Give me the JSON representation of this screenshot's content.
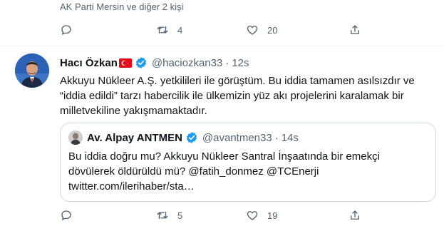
{
  "previous_tweet": {
    "liked_by": "AK Parti Mersin ve diğer 2 kişi",
    "retweets": "4",
    "likes": "20"
  },
  "tweet": {
    "name": "Hacı Özkan",
    "handle": "@haciozkan33",
    "dot": "·",
    "time": "12s",
    "lines": [
      "Akkuyu Nükleer A.Ş. yetkilileri ile görüştüm. Bu iddia tamamen asılsızdır ve",
      "“iddia edildi” tarzı habercilik ile ülkemizin yüz akı projelerini karalamak bir",
      "milletvekiline yakışmamaktadır."
    ],
    "retweets": "5",
    "likes": "19"
  },
  "quoted_tweet": {
    "name": "Av. Alpay ANTMEN",
    "handle": "@avantmen33",
    "dot": "·",
    "time": "14s",
    "lines": [
      "Bu iddia doğru mu? Akkuyu Nükleer Santral İnşaatında bir emekçi",
      "dövülerek öldürüldü mü? @fatih_donmez @TCEnerji",
      "twitter.com/ilerihaber/sta…"
    ]
  },
  "icons": {
    "reply": "reply-icon",
    "retweet": "retweet-icon",
    "like": "heart-icon",
    "share": "share-icon",
    "verified": "verified-badge-icon",
    "flag": "turkey-flag-icon"
  },
  "colors": {
    "secondary_text": "#536471",
    "verified_blue": "#1d9bf0",
    "flag_red": "#e30a17",
    "border": "#cfd9de"
  }
}
